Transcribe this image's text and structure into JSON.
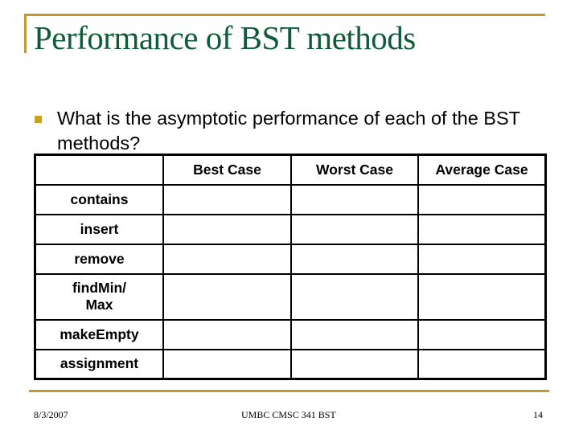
{
  "slide": {
    "title": "Performance of BST methods",
    "bullet": "What is the asymptotic performance of each of the BST methods?",
    "accent_color": "#C09A2E",
    "title_color": "#0F5A3A"
  },
  "table": {
    "headers": [
      "",
      "Best Case",
      "Worst Case",
      "Average Case"
    ],
    "rows": [
      {
        "method": "contains",
        "best": "",
        "worst": "",
        "average": ""
      },
      {
        "method": "insert",
        "best": "",
        "worst": "",
        "average": ""
      },
      {
        "method": "remove",
        "best": "",
        "worst": "",
        "average": ""
      },
      {
        "method": "findMin/ Max",
        "best": "",
        "worst": "",
        "average": ""
      },
      {
        "method": "makeEmpty",
        "best": "",
        "worst": "",
        "average": ""
      },
      {
        "method": "assignment",
        "best": "",
        "worst": "",
        "average": ""
      }
    ]
  },
  "footer": {
    "date": "8/3/2007",
    "center": "UMBC CMSC 341 BST",
    "page": "14"
  }
}
